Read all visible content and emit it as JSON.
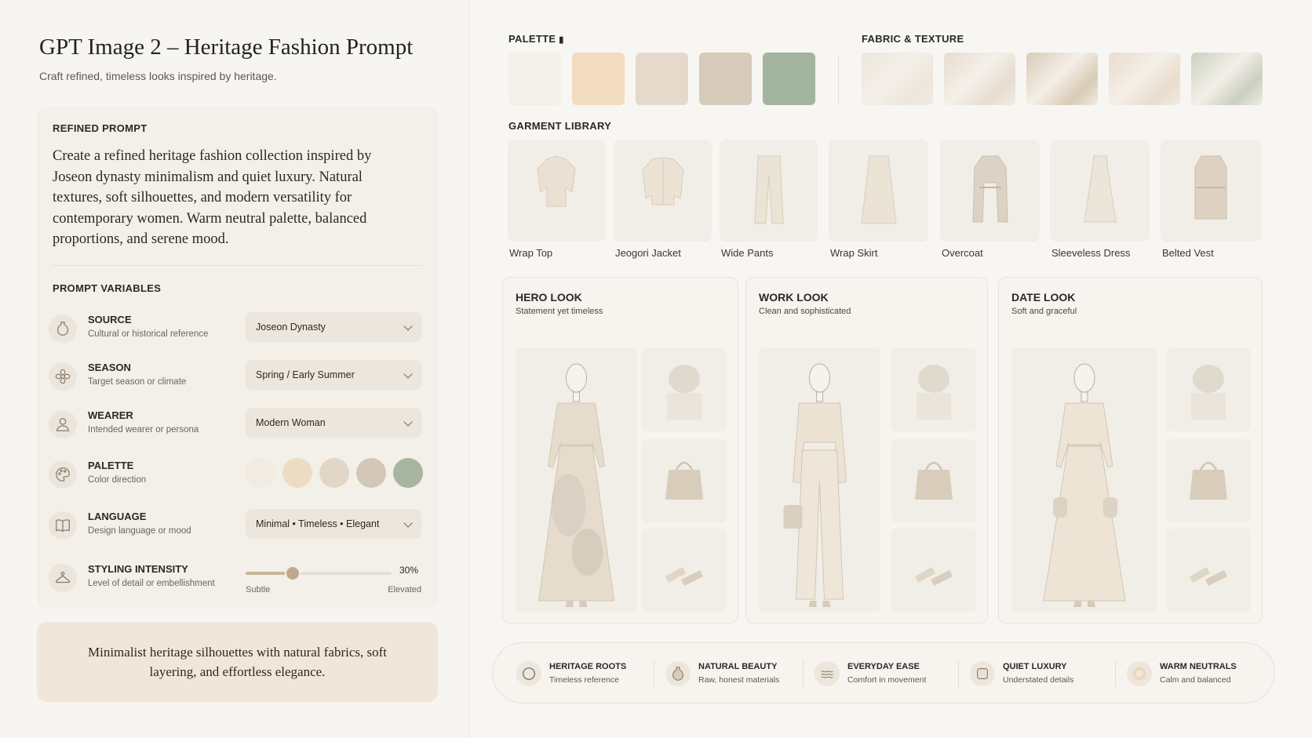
{
  "header": {
    "title": "GPT Image 2 – Heritage Fashion Prompt",
    "subtitle": "Craft refined, timeless looks inspired by heritage."
  },
  "refined_prompt": {
    "label": "REFINED PROMPT",
    "text": "Create a refined heritage fashion collection inspired by Joseon dynasty minimalism and quiet luxury. Natural textures, soft silhouettes, and modern versatility for contemporary women. Warm neutral palette, balanced proportions, and serene mood."
  },
  "variables": {
    "label": "PROMPT VARIABLES",
    "source": {
      "title": "SOURCE",
      "desc": "Cultural or historical reference",
      "value": "Joseon Dynasty",
      "icon": "vase-icon"
    },
    "season": {
      "title": "SEASON",
      "desc": "Target season or climate",
      "value": "Spring / Early Summer",
      "icon": "flower-icon"
    },
    "wearer": {
      "title": "WEARER",
      "desc": "Intended wearer or persona",
      "value": "Modern Woman",
      "icon": "person-icon"
    },
    "palette": {
      "title": "PALETTE",
      "desc": "Color direction",
      "icon": "palette-icon",
      "swatches": [
        "#f1ebe1",
        "#ecdcc4",
        "#e2d6c7",
        "#d2c7b8",
        "#a8b5a1"
      ]
    },
    "language": {
      "title": "LANGUAGE",
      "desc": "Design language or mood",
      "value": "Minimal • Timeless • Elegant",
      "icon": "book-icon"
    },
    "styling": {
      "title": "STYLING INTENSITY",
      "desc": "Level of detail or embellishment",
      "value": 30,
      "value_label": "30%",
      "min_label": "Subtle",
      "max_label": "Elevated",
      "icon": "hanger-icon"
    }
  },
  "summary": "Minimalist heritage silhouettes with natural fabrics, soft layering, and effortless elegance.",
  "palette": {
    "label": "PALETTE",
    "colors": [
      "#f3f0ea",
      "#f1dcc1",
      "#e5d9cb",
      "#d6cabb",
      "#a3b49f"
    ]
  },
  "fabric": {
    "label": "FABRIC & TEXTURE",
    "colors": [
      "#ece6dc",
      "#e6ddd0",
      "#d9cbb6",
      "#e9ddcd",
      "#c9d0c1"
    ]
  },
  "garments": {
    "label": "GARMENT LIBRARY",
    "items": [
      "Wrap Top",
      "Jeogori Jacket",
      "Wide Pants",
      "Wrap Skirt",
      "Overcoat",
      "Sleeveless Dress",
      "Belted Vest"
    ]
  },
  "looks": [
    {
      "title": "HERO LOOK",
      "subtitle": "Statement yet timeless"
    },
    {
      "title": "WORK LOOK",
      "subtitle": "Clean and sophisticated"
    },
    {
      "title": "DATE LOOK",
      "subtitle": "Soft and graceful"
    }
  ],
  "features": [
    {
      "title": "HERITAGE ROOTS",
      "desc": "Timeless reference",
      "icon": "circle-icon"
    },
    {
      "title": "NATURAL BEAUTY",
      "desc": "Raw, honest materials",
      "icon": "vase-icon"
    },
    {
      "title": "EVERYDAY EASE",
      "desc": "Comfort in movement",
      "icon": "wave-icon"
    },
    {
      "title": "QUIET LUXURY",
      "desc": "Understated details",
      "icon": "fabric-icon"
    },
    {
      "title": "WARM NEUTRALS",
      "desc": "Calm and balanced",
      "icon": "glow-icon"
    }
  ]
}
